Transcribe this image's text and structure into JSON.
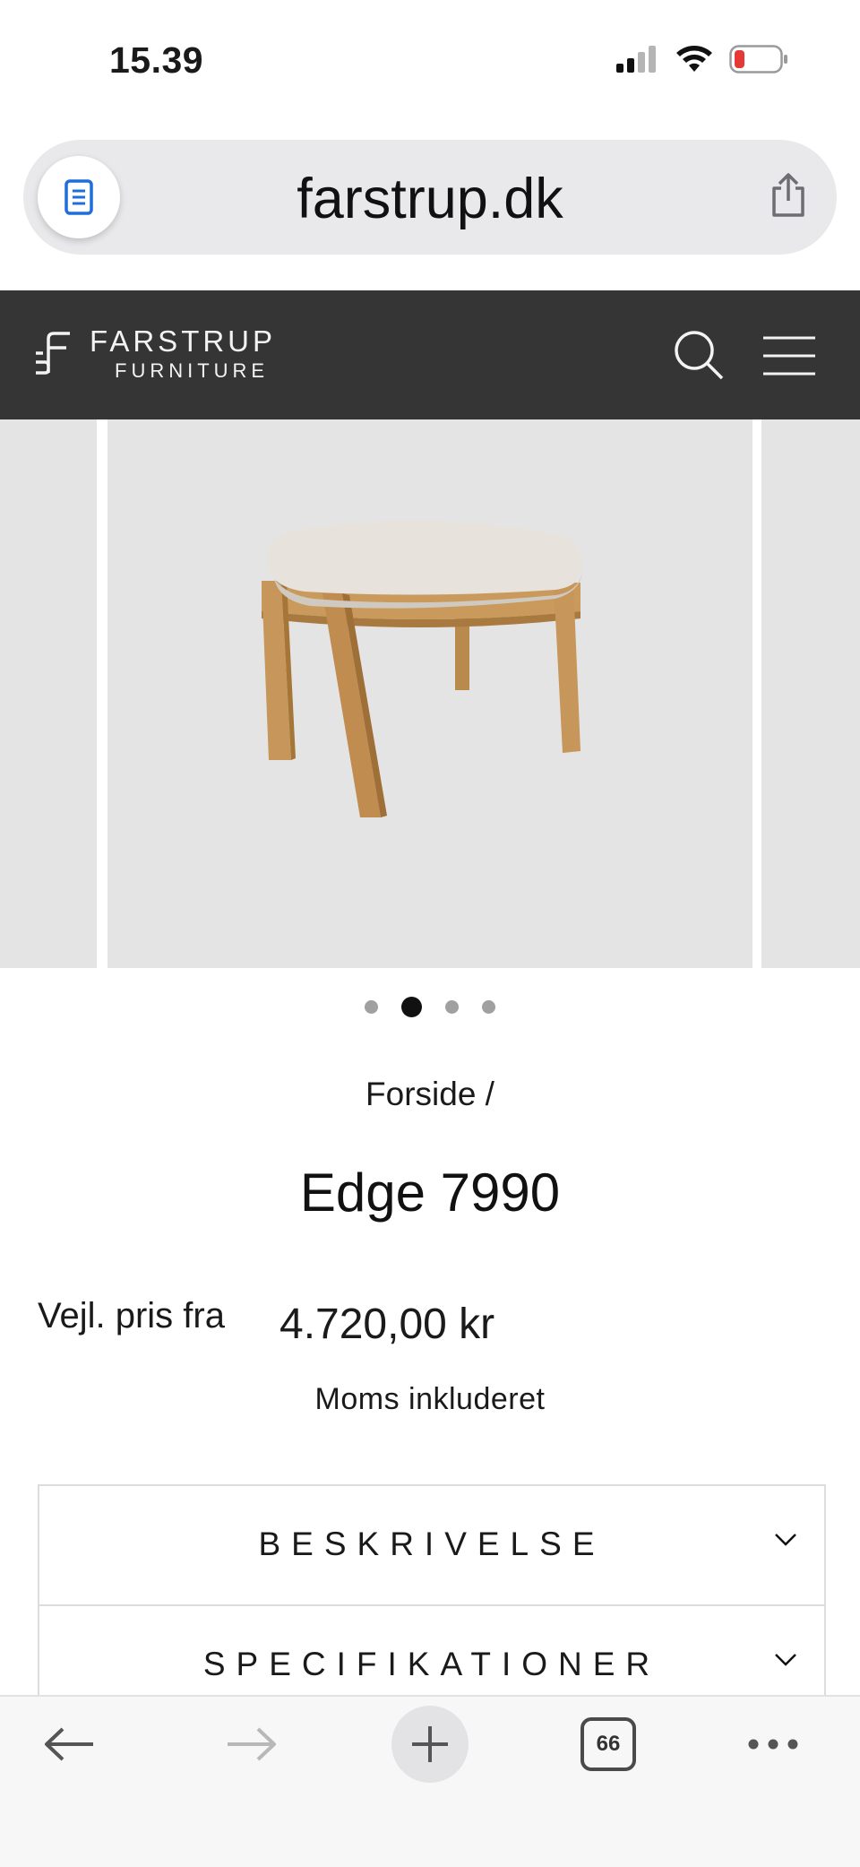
{
  "status_bar": {
    "time": "15.39",
    "battery_color": "#e53935"
  },
  "browser": {
    "url": "farstrup.dk",
    "open_tabs": "66"
  },
  "site": {
    "brand_name": "FARSTRUP",
    "brand_sub": "FURNITURE",
    "header_bg": "#353535"
  },
  "gallery": {
    "slide_count": 4,
    "active_slide": 2
  },
  "product": {
    "breadcrumb": "Forside /",
    "title": "Edge 7990",
    "price_label": "Vejl. pris fra",
    "price": "4.720,00 kr",
    "vat_note": "Moms inkluderet"
  },
  "accordion": [
    {
      "label": "BESKRIVELSE"
    },
    {
      "label": "SPECIFIKATIONER"
    }
  ],
  "icons": {
    "reader": "reader-icon",
    "share": "share-icon",
    "search": "search-icon",
    "menu": "hamburger-menu-icon",
    "zoom": "zoom-icon",
    "chevron": "chevron-down-icon",
    "back": "back-arrow-icon",
    "forward": "forward-arrow-icon",
    "new_tab": "plus-icon",
    "tabs": "tabs-icon",
    "more": "more-icon"
  }
}
